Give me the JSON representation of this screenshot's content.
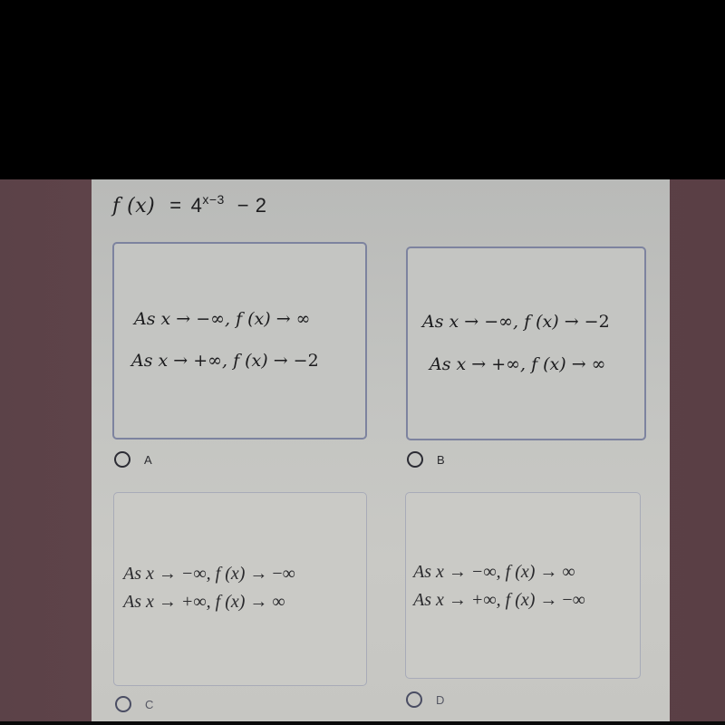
{
  "question": {
    "function_name": "f (x)",
    "equals": "=",
    "base": "4",
    "exponent": "x−3",
    "constant": "− 2"
  },
  "options": [
    {
      "id": "A",
      "label": "A",
      "lines": [
        {
          "prefix": "As x → −∞, ",
          "fx": "f (x)",
          "suffix": " → ∞"
        },
        {
          "prefix": "As x → +∞, ",
          "fx": "f (x)",
          "suffix": " → −2"
        }
      ],
      "selected": false
    },
    {
      "id": "B",
      "label": "B",
      "lines": [
        {
          "prefix": "As x → −∞, ",
          "fx": "f (x)",
          "suffix": " → −2"
        },
        {
          "prefix": "As x → +∞, ",
          "fx": "f (x)",
          "suffix": " → ∞"
        }
      ],
      "selected": false
    },
    {
      "id": "C",
      "label": "C",
      "lines": [
        {
          "prefix": "As x → −∞,  ",
          "fx": "f (x)",
          "suffix": " → −∞"
        },
        {
          "prefix": "As x → +∞,  ",
          "fx": "f (x)",
          "suffix": " → ∞"
        }
      ],
      "selected": false
    },
    {
      "id": "D",
      "label": "D",
      "lines": [
        {
          "prefix": "As x → −∞,  ",
          "fx": "f (x)",
          "suffix": " → ∞"
        },
        {
          "prefix": "As x → +∞,  ",
          "fx": "f (x)",
          "suffix": " → −∞"
        }
      ],
      "selected": false
    }
  ],
  "colors": {
    "screen_side": "#5a3f45",
    "panel": "#c3c4c1",
    "card_border": "#7e84a0",
    "text": "#1c1c1e"
  }
}
